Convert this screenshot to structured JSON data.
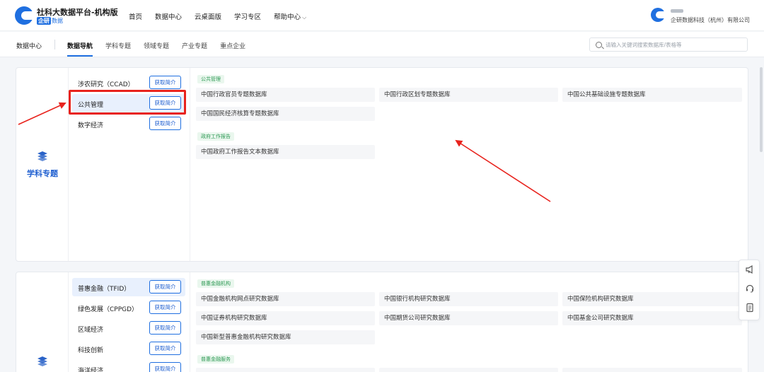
{
  "header": {
    "brand_title": "社科大数据平台-机构版",
    "brand_tag": "企研",
    "brand_sub": "数据",
    "nav": [
      {
        "label": "首页"
      },
      {
        "label": "数据中心"
      },
      {
        "label": "云桌面版"
      },
      {
        "label": "学习专区"
      },
      {
        "label": "帮助中心"
      }
    ],
    "company": "企研数据科技（杭州）有限公司"
  },
  "subnav": {
    "home": "数据中心",
    "items": [
      {
        "label": "数据导航",
        "active": true
      },
      {
        "label": "学科专题"
      },
      {
        "label": "领域专题"
      },
      {
        "label": "产业专题"
      },
      {
        "label": "重点企业"
      }
    ],
    "search_placeholder": "请输入关键词搜索数据库/表格等"
  },
  "panel1": {
    "title": "学科专题",
    "categories": [
      {
        "label": "涉农研究（CCAD）",
        "button": "获取简介"
      },
      {
        "label": "公共管理",
        "button": "获取简介",
        "selected": true
      },
      {
        "label": "数字经济",
        "button": "获取简介"
      }
    ],
    "groups": [
      {
        "tag": "公共管理",
        "items": [
          "中国行政官员专题数据库",
          "中国行政区划专题数据库",
          "中国公共基础设施专题数据库",
          "中国国民经济核算专题数据库"
        ]
      },
      {
        "tag": "政府工作报告",
        "items": [
          "中国政府工作报告文本数据库"
        ]
      }
    ]
  },
  "panel2": {
    "categories": [
      {
        "label": "普惠金融（TFID）",
        "button": "获取简介",
        "selected": true
      },
      {
        "label": "绿色发展（CPPGD）",
        "button": "获取简介"
      },
      {
        "label": "区域经济",
        "button": "获取简介"
      },
      {
        "label": "科技创新",
        "button": "获取简介"
      },
      {
        "label": "海洋经济",
        "button": "获取简介"
      }
    ],
    "groups": [
      {
        "tag": "普惠金融机构",
        "items": [
          "中国金融机构网点研究数据库",
          "中国银行机构研究数据库",
          "中国保险机构研究数据库",
          "中国证券机构研究数据库",
          "中国期货公司研究数据库",
          "中国基金公司研究数据库",
          "中国新型普惠金融机构研究数据库"
        ]
      },
      {
        "tag": "普惠金融服务",
        "items": []
      }
    ]
  },
  "float_toolbar": [
    "megaphone-icon",
    "headset-icon",
    "document-icon"
  ],
  "colors": {
    "accent": "#1f6fe0",
    "highlight": "#e8231d",
    "tag_green": "#2f9a55"
  }
}
